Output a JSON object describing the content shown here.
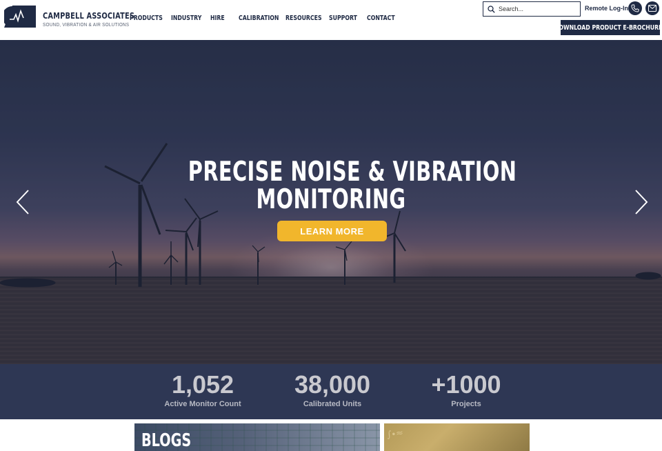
{
  "brand": {
    "name": "CAMPBELL ASSOCIATES",
    "tagline": "SOUND, VIBRATION & AIR SOLUTIONS",
    "logo_icon": "waveform-triangle-logo",
    "color": "#1f2a44"
  },
  "nav": {
    "items": [
      {
        "label": "PRODUCTS"
      },
      {
        "label": "INDUSTRY"
      },
      {
        "label": "HIRE"
      },
      {
        "label": "CALIBRATION"
      },
      {
        "label": "RESOURCES"
      },
      {
        "label": "SUPPORT"
      },
      {
        "label": "CONTACT"
      }
    ]
  },
  "search": {
    "placeholder": "Search...",
    "icon": "search-icon"
  },
  "header_actions": {
    "remote_login": "Remote Log-In",
    "phone_icon": "phone-icon",
    "email_icon": "mail-icon",
    "download_label": "DOWNLOAD PRODUCT E-BROCHURES"
  },
  "hero": {
    "title_line1": "PRECISE NOISE & VIBRATION",
    "title_line2": "MONITORING",
    "cta_label": "LEARN MORE",
    "cta_color": "#f1b62c",
    "prev_icon": "chevron-left-icon",
    "next_icon": "chevron-right-icon"
  },
  "stats": [
    {
      "value": "1,052",
      "label": "Active Monitor Count"
    },
    {
      "value": "38,000",
      "label": "Calibrated Units"
    },
    {
      "value": "+1000",
      "label": "Projects"
    }
  ],
  "cards": {
    "blogs_label": "BLOGS"
  }
}
